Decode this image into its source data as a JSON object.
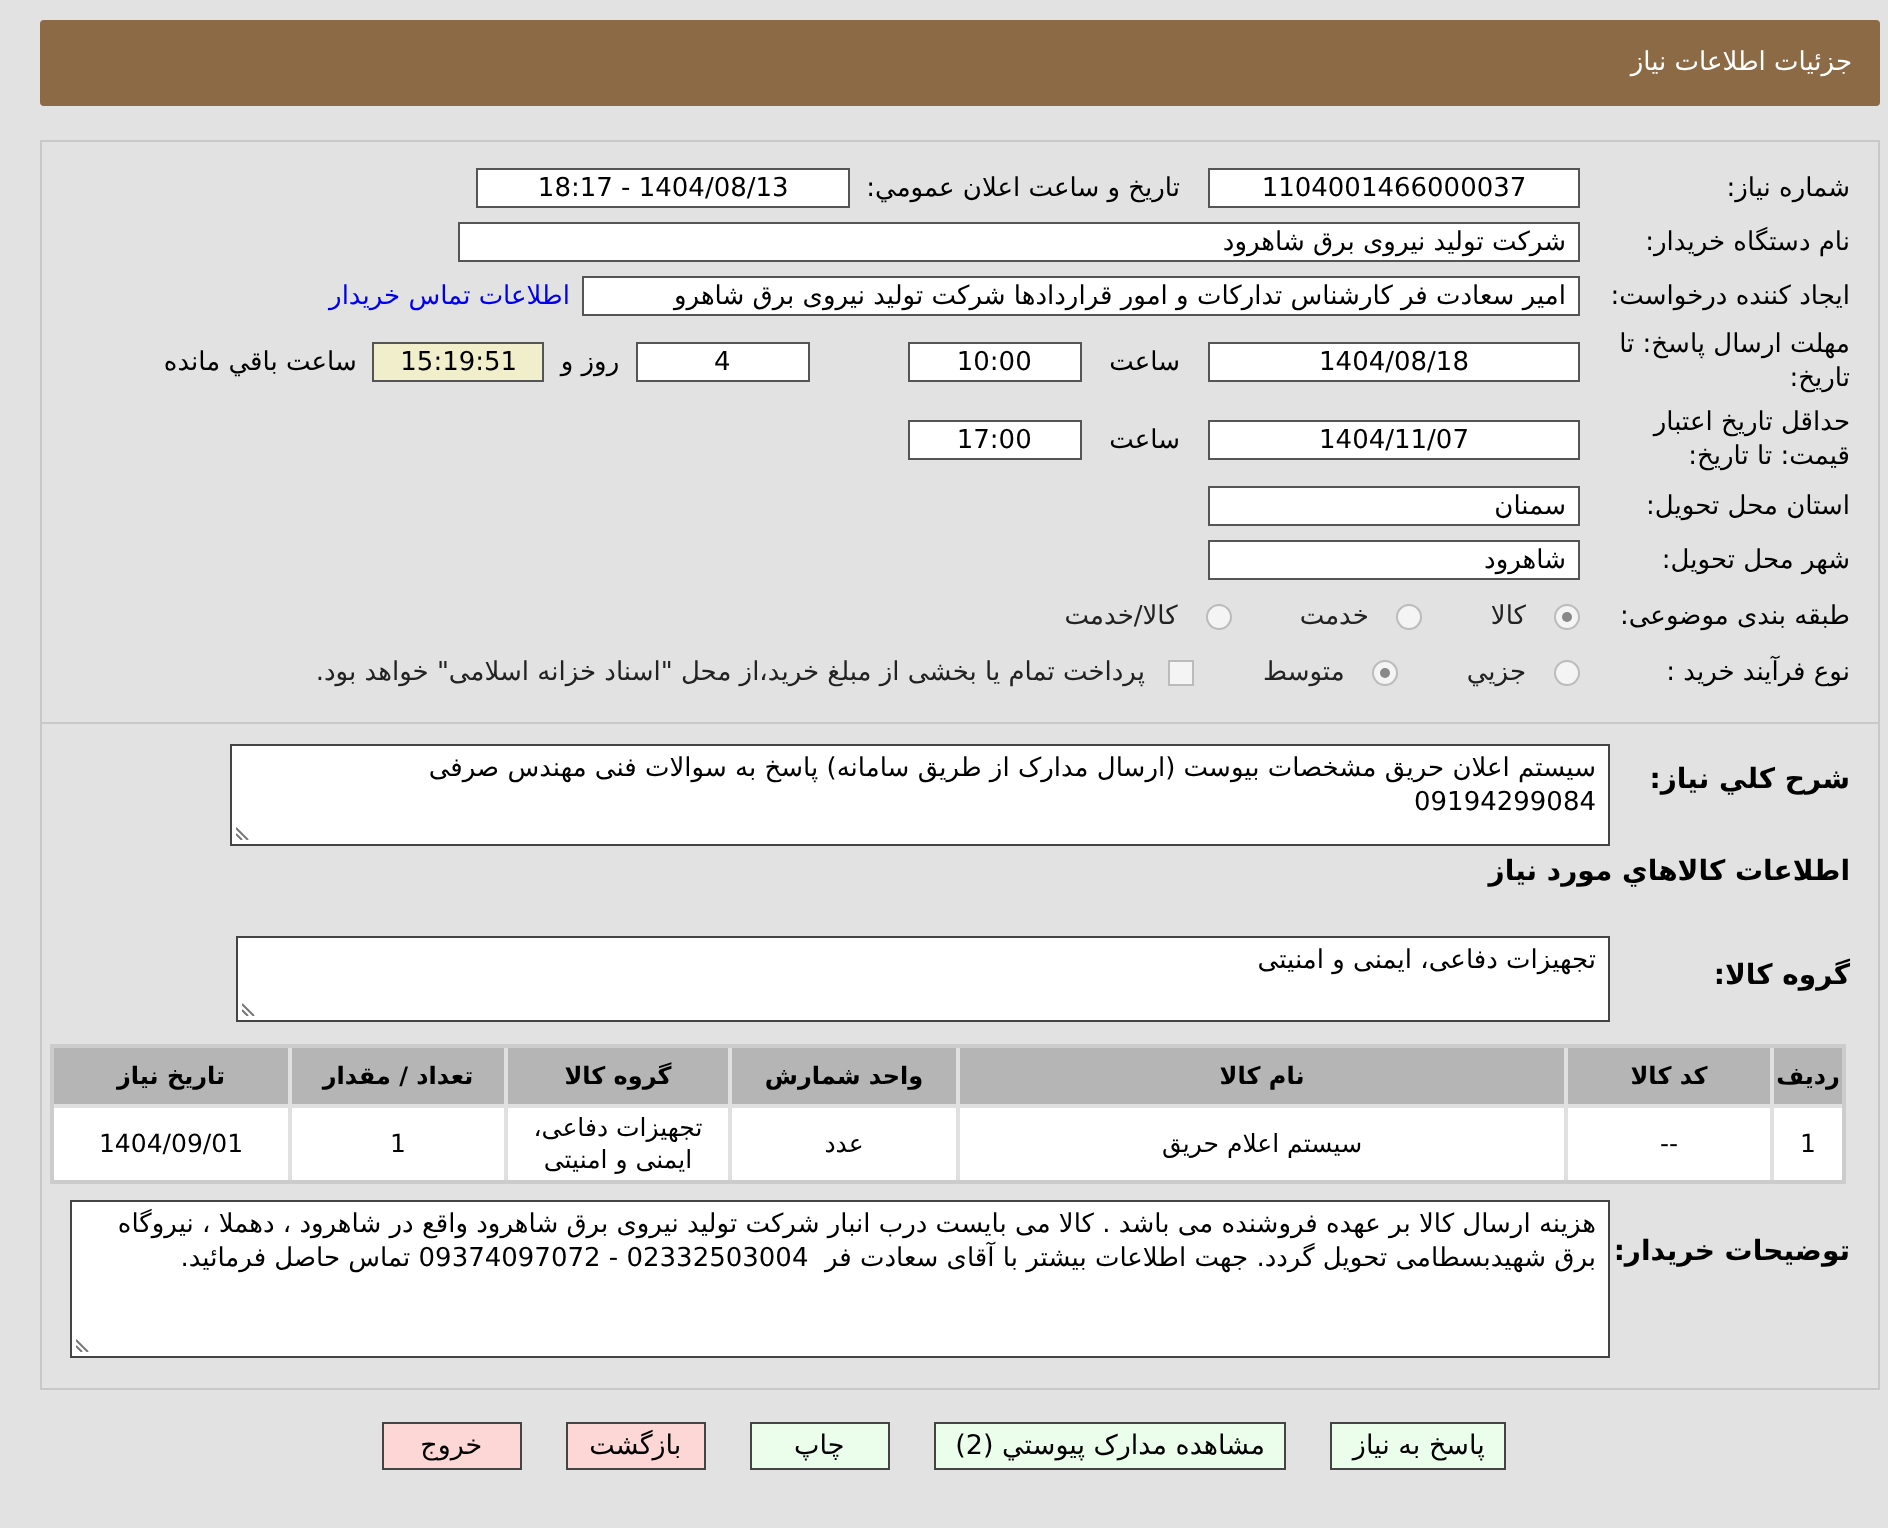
{
  "header": {
    "title": "جزئیات اطلاعات نیاز"
  },
  "need_number": {
    "label": "شماره نیاز:",
    "value": "1104001466000037"
  },
  "announce": {
    "label": "تاریخ و ساعت اعلان عمومي:",
    "value": "1404/08/13 - 18:17"
  },
  "buyer_org": {
    "label": "نام دستگاه خریدار:",
    "value": "شرکت تولید نیروی برق شاهرود"
  },
  "creator": {
    "label": "ایجاد کننده درخواست:",
    "value": "امیر سعادت فر کارشناس تدارکات و امور قراردادها شرکت تولید نیروی برق شاهرو",
    "link": "اطلاعات تماس خریدار"
  },
  "deadline": {
    "label": "مهلت ارسال پاسخ: تا تاریخ:",
    "date": "1404/08/18",
    "time_label": "ساعت",
    "time": "10:00",
    "days": "4",
    "days_label": "روز و",
    "remaining": "15:19:51",
    "remaining_label": "ساعت باقي مانده"
  },
  "validity": {
    "label": "حداقل تاریخ اعتبار قیمت: تا تاریخ:",
    "date": "1404/11/07",
    "time_label": "ساعت",
    "time": "17:00"
  },
  "province": {
    "label": "استان محل تحویل:",
    "value": "سمنان"
  },
  "city": {
    "label": "شهر محل تحویل:",
    "value": "شاهرود"
  },
  "category": {
    "label": "طبقه بندی موضوعی:",
    "options": [
      {
        "label": "کالا",
        "selected": true
      },
      {
        "label": "خدمت",
        "selected": false
      },
      {
        "label": "کالا/خدمت",
        "selected": false
      }
    ]
  },
  "purchase_type": {
    "label": "نوع فرآیند خرید :",
    "options": [
      {
        "label": "جزيي",
        "selected": false
      },
      {
        "label": "متوسط",
        "selected": true
      }
    ],
    "payment": {
      "checked": false,
      "text": "پرداخت تمام یا بخشی از مبلغ خرید،از محل \"اسناد خزانه اسلامی\" خواهد بود."
    }
  },
  "description": {
    "label": "شرح کلي نیاز:",
    "value": "سیستم اعلان حریق مشخصات بیوست (ارسال مدارک از طریق سامانه) پاسخ به سوالات فنی مهندس صرفی 09194299084"
  },
  "goods_heading": "اطلاعات کالاهاي مورد نیاز",
  "goods_group": {
    "label": "گروه کالا:",
    "value": "تجهیزات دفاعی، ایمنی و امنیتی"
  },
  "table": {
    "columns": [
      "ردیف",
      "کد کالا",
      "نام کالا",
      "واحد شمارش",
      "گروه کالا",
      "تعداد / مقدار",
      "تاریخ نیاز"
    ],
    "rows": [
      [
        "1",
        "--",
        "سیستم اعلام حریق",
        "عدد",
        "تجهیزات دفاعی، ایمنی و امنیتی",
        "1",
        "1404/09/01"
      ]
    ]
  },
  "buyer_notes": {
    "label": "توضیحات خریدار:",
    "value": "هزینه ارسال کالا بر عهده فروشنده می باشد . کالا می بایست درب انبار شرکت تولید نیروی برق شاهرود واقع در شاهرود ، دهملا ، نیروگاه برق شهیدبسطامی تحویل گردد. جهت اطلاعات بیشتر با آقای سعادت فر  02332503004 - 09374097072 تماس حاصل فرمائید."
  },
  "buttons": [
    {
      "label": "پاسخ به نیاز",
      "kind": "action"
    },
    {
      "label": "مشاهده مدارک پیوستي (2)",
      "kind": "action"
    },
    {
      "label": "چاپ",
      "kind": "action"
    },
    {
      "label": "بازگشت",
      "kind": "exit"
    },
    {
      "label": "خروج",
      "kind": "exit"
    }
  ]
}
